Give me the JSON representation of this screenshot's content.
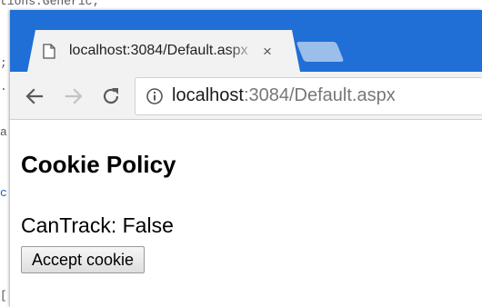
{
  "background_code": {
    "lines": [
      {
        "text": "tions.Generic;",
        "cls": ""
      },
      {
        "text": ";",
        "cls": ""
      },
      {
        "text": ".",
        "cls": ""
      },
      {
        "text": "a",
        "cls": ""
      },
      {
        "text": "c",
        "cls": "code-blue"
      },
      {
        "text": "[",
        "cls": ""
      }
    ]
  },
  "browser": {
    "tab": {
      "title": "localhost:3084/Default.aspx",
      "close_glyph": "×",
      "favicon": "page-icon"
    },
    "new_tab": "new-tab-button",
    "nav": {
      "back_icon": "back-arrow-icon",
      "forward_icon": "forward-arrow-icon",
      "reload_icon": "reload-icon"
    },
    "address": {
      "host": "localhost",
      "rest": ":3084/Default.aspx",
      "security_icon": "info-icon"
    },
    "colors": {
      "titlebar": "#1f6fd6",
      "toolbar": "#f2f2f2"
    }
  },
  "page": {
    "heading": "Cookie Policy",
    "cantrack_text": "CanTrack: False",
    "accept_button": "Accept cookie"
  }
}
